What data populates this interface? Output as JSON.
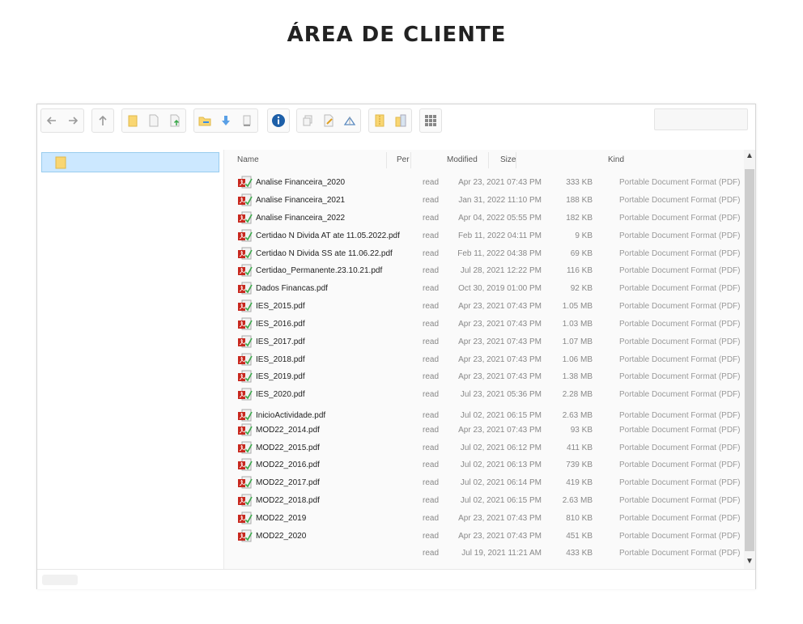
{
  "page": {
    "title": "ÁREA DE CLIENTE"
  },
  "toolbar": {
    "icons": [
      "back-arrow-icon",
      "forward-arrow-icon",
      "up-arrow-icon",
      "new-folder-icon",
      "new-file-icon",
      "upload-icon",
      "open-folder-icon",
      "download-icon",
      "document-icon",
      "info-icon",
      "copy-icon",
      "edit-icon",
      "resize-icon",
      "archive-icon",
      "extract-icon",
      "grid-view-icon"
    ],
    "search": {
      "value": ""
    }
  },
  "tree": {
    "selected_label": ""
  },
  "columns": {
    "name": "Name",
    "perm": "Per",
    "modified": "Modified",
    "size": "Size",
    "kind": "Kind"
  },
  "files": [
    {
      "name": "Analise Financeira_2020",
      "perm": "read",
      "modified": "Apr 23, 2021 07:43 PM",
      "size": "333 KB",
      "kind": "Portable Document Format (PDF)"
    },
    {
      "name": "Analise Financeira_2021",
      "perm": "read",
      "modified": "Jan 31, 2022 11:10 PM",
      "size": "188 KB",
      "kind": "Portable Document Format (PDF)"
    },
    {
      "name": "Analise Financeira_2022",
      "perm": "read",
      "modified": "Apr 04, 2022 05:55 PM",
      "size": "182 KB",
      "kind": "Portable Document Format (PDF)"
    },
    {
      "name": "Certidao N Divida AT ate 11.05.2022.pdf",
      "perm": "read",
      "modified": "Feb 11, 2022 04:11 PM",
      "size": "9 KB",
      "kind": "Portable Document Format (PDF)"
    },
    {
      "name": "Certidao N Divida SS ate 11.06.22.pdf",
      "perm": "read",
      "modified": "Feb 11, 2022 04:38 PM",
      "size": "69 KB",
      "kind": "Portable Document Format (PDF)"
    },
    {
      "name": "Certidao_Permanente.23.10.21.pdf",
      "perm": "read",
      "modified": "Jul 28, 2021 12:22 PM",
      "size": "116 KB",
      "kind": "Portable Document Format (PDF)"
    },
    {
      "name": "Dados Financas.pdf",
      "perm": "read",
      "modified": "Oct 30, 2019 01:00 PM",
      "size": "92 KB",
      "kind": "Portable Document Format (PDF)"
    },
    {
      "name": "IES_2015.pdf",
      "perm": "read",
      "modified": "Apr 23, 2021 07:43 PM",
      "size": "1.05 MB",
      "kind": "Portable Document Format (PDF)"
    },
    {
      "name": "IES_2016.pdf",
      "perm": "read",
      "modified": "Apr 23, 2021 07:43 PM",
      "size": "1.03 MB",
      "kind": "Portable Document Format (PDF)"
    },
    {
      "name": "IES_2017.pdf",
      "perm": "read",
      "modified": "Apr 23, 2021 07:43 PM",
      "size": "1.07 MB",
      "kind": "Portable Document Format (PDF)"
    },
    {
      "name": "IES_2018.pdf",
      "perm": "read",
      "modified": "Apr 23, 2021 07:43 PM",
      "size": "1.06 MB",
      "kind": "Portable Document Format (PDF)"
    },
    {
      "name": "IES_2019.pdf",
      "perm": "read",
      "modified": "Apr 23, 2021 07:43 PM",
      "size": "1.38 MB",
      "kind": "Portable Document Format (PDF)"
    },
    {
      "name": "IES_2020.pdf",
      "perm": "read",
      "modified": "Jul 23, 2021 05:36 PM",
      "size": "2.28 MB",
      "kind": "Portable Document Format (PDF)"
    },
    {
      "name": "InicioActividade.pdf",
      "perm": "read",
      "modified": "Jul 02, 2021 06:15 PM",
      "size": "2.63 MB",
      "kind": "Portable Document Format (PDF)"
    },
    {
      "name": "MOD22_2014.pdf",
      "perm": "read",
      "modified": "Apr 23, 2021 07:43 PM",
      "size": "93 KB",
      "kind": "Portable Document Format (PDF)"
    },
    {
      "name": "MOD22_2015.pdf",
      "perm": "read",
      "modified": "Jul 02, 2021 06:12 PM",
      "size": "411 KB",
      "kind": "Portable Document Format (PDF)"
    },
    {
      "name": "MOD22_2016.pdf",
      "perm": "read",
      "modified": "Jul 02, 2021 06:13 PM",
      "size": "739 KB",
      "kind": "Portable Document Format (PDF)"
    },
    {
      "name": "MOD22_2017.pdf",
      "perm": "read",
      "modified": "Jul 02, 2021 06:14 PM",
      "size": "419 KB",
      "kind": "Portable Document Format (PDF)"
    },
    {
      "name": "MOD22_2018.pdf",
      "perm": "read",
      "modified": "Jul 02, 2021 06:15 PM",
      "size": "2.63 MB",
      "kind": "Portable Document Format (PDF)"
    },
    {
      "name": "MOD22_2019",
      "perm": "read",
      "modified": "Apr 23, 2021 07:43 PM",
      "size": "810 KB",
      "kind": "Portable Document Format (PDF)"
    },
    {
      "name": "MOD22_2020",
      "perm": "read",
      "modified": "Apr 23, 2021 07:43 PM",
      "size": "451 KB",
      "kind": "Portable Document Format (PDF)"
    },
    {
      "name": "",
      "perm": "read",
      "modified": "Jul 19, 2021 11:21 AM",
      "size": "433 KB",
      "kind": "Portable Document Format (PDF)"
    }
  ],
  "colors": {
    "selected_bg": "#cce8ff",
    "pdf_red": "#c8281e",
    "info_blue": "#1d5fa8",
    "folder_yellow": "#f9d672"
  }
}
